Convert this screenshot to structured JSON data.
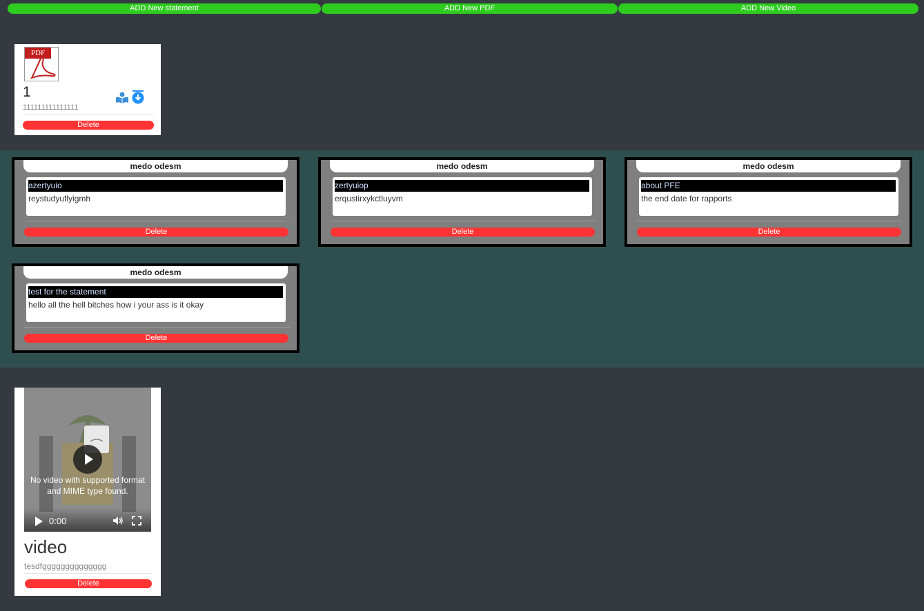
{
  "toolbar": {
    "add_statement": "ADD New statement",
    "add_pdf": "ADD New PDF",
    "add_video": "ADD New Video"
  },
  "pdf_card": {
    "icon_label": "PDF",
    "title": "1",
    "description": "111111111111111",
    "delete_label": "Delete"
  },
  "statements": [
    {
      "author": "medo odesm",
      "subject": "azertyuio",
      "text": "reystudyuflyigmh",
      "delete_label": "Delete"
    },
    {
      "author": "medo odesm",
      "subject": "zertyuiop",
      "text": "erqustirxykctluyvm",
      "delete_label": "Delete"
    },
    {
      "author": "medo odesm",
      "subject": "about PFE",
      "text": "the end date for rapports",
      "delete_label": "Delete"
    },
    {
      "author": "medo odesm",
      "subject": "test for the statement",
      "text": "hello all the hell bitches how i your ass is it okay",
      "delete_label": "Delete"
    }
  ],
  "video_card": {
    "player_message": "No video with supported format and MIME type found.",
    "time": "0:00",
    "title": "video",
    "description": "tesdfgggggggggggggg",
    "delete_label": "Delete"
  },
  "colors": {
    "add_button": "#2ecc1f",
    "delete_button": "#ff3333",
    "page_bg": "#343a40",
    "statements_bg": "#2f4f4f"
  }
}
